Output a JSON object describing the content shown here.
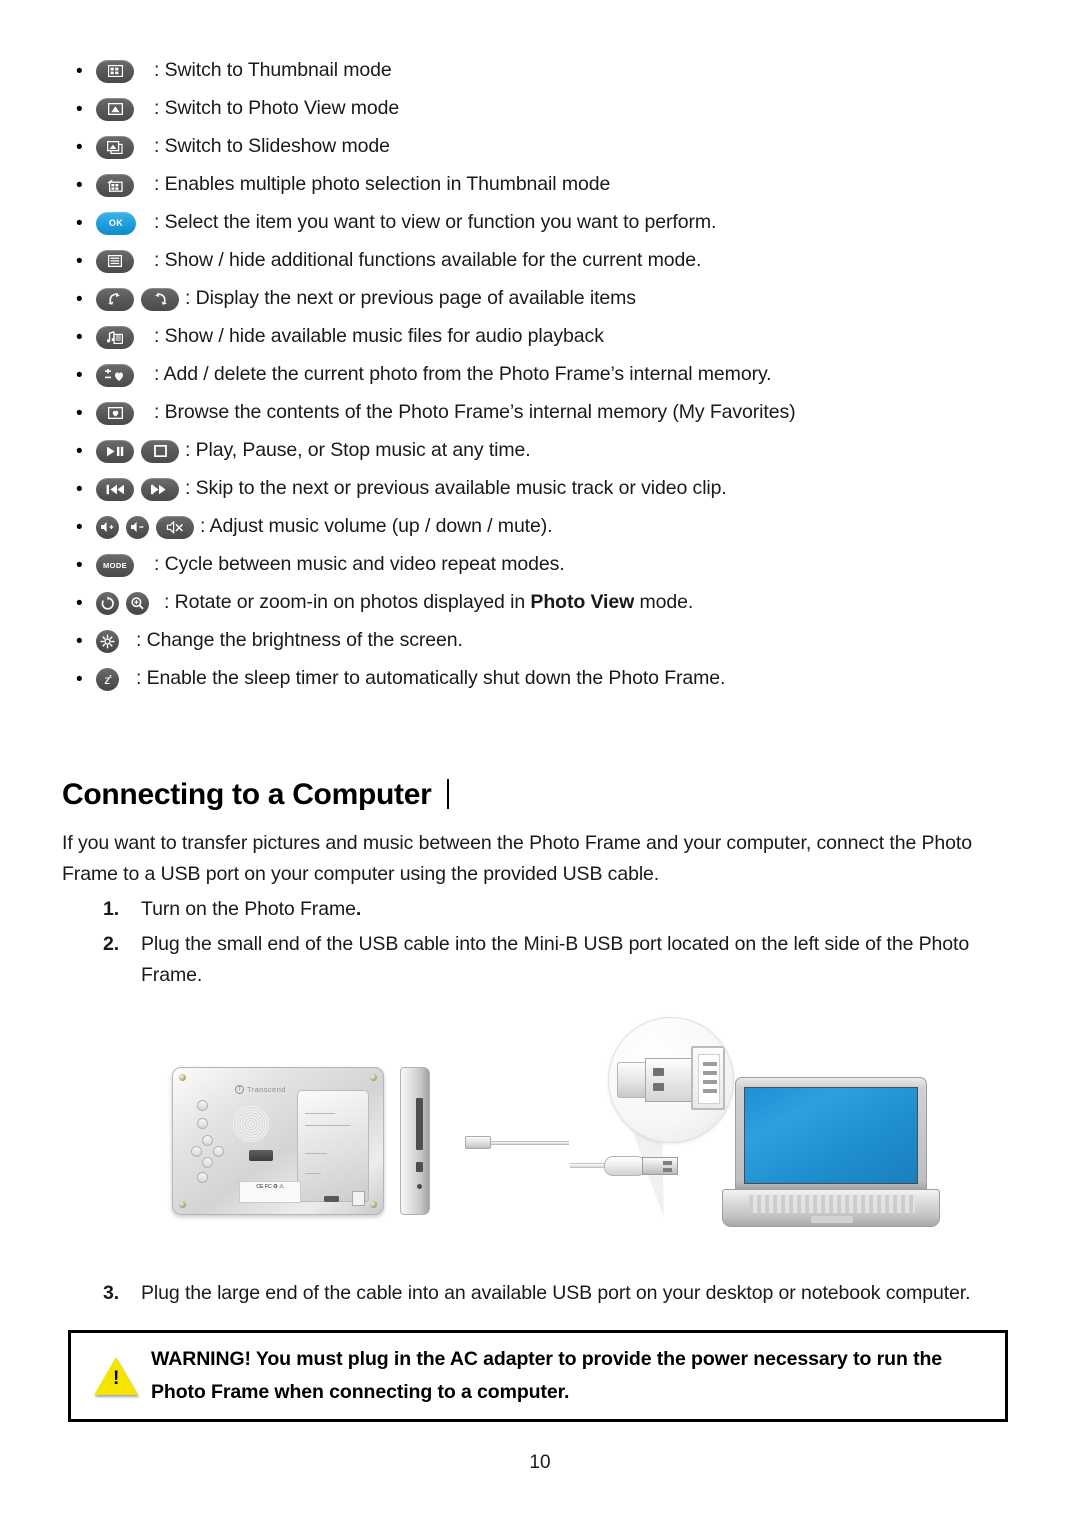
{
  "page_number": "10",
  "bullets": [
    {
      "icons": [
        "thumbnail-mode-icon"
      ],
      "text": ": Switch to Thumbnail mode"
    },
    {
      "icons": [
        "photo-view-mode-icon"
      ],
      "text": ": Switch to Photo View mode"
    },
    {
      "icons": [
        "slideshow-mode-icon"
      ],
      "text": ": Switch to Slideshow mode"
    },
    {
      "icons": [
        "multi-select-icon"
      ],
      "text": ": Enables multiple photo selection in Thumbnail mode"
    },
    {
      "icons": [
        "ok-button-icon"
      ],
      "text": ": Select the item you want to view or function you want to perform."
    },
    {
      "icons": [
        "menu-icon"
      ],
      "text": ": Show / hide additional functions available for the current mode."
    },
    {
      "icons": [
        "page-next-icon",
        "page-previous-icon"
      ],
      "text": ": Display the next or previous page of available items"
    },
    {
      "icons": [
        "music-files-icon"
      ],
      "text": ": Show / hide available music files for audio playback"
    },
    {
      "icons": [
        "favorite-add-delete-icon"
      ],
      "text": ": Add / delete the current photo from the Photo Frame’s internal memory."
    },
    {
      "icons": [
        "my-favorites-browse-icon"
      ],
      "text": ": Browse the contents of the Photo Frame’s internal memory (My Favorites)"
    },
    {
      "icons": [
        "play-pause-icon",
        "stop-icon"
      ],
      "text": ": Play, Pause, or Stop music at any time."
    },
    {
      "icons": [
        "previous-track-icon",
        "next-track-icon"
      ],
      "text": ": Skip to the next or previous available music track or video clip."
    },
    {
      "icons": [
        "volume-up-icon",
        "volume-down-icon",
        "mute-icon"
      ],
      "text": ": Adjust music volume (up / down / mute)."
    },
    {
      "icons": [
        "mode-button-icon"
      ],
      "text": ": Cycle between music and video repeat modes."
    },
    {
      "icons": [
        "rotate-icon",
        "zoom-in-icon"
      ],
      "text_pre": ": Rotate or zoom-in on photos displayed in ",
      "text_bold": "Photo View",
      "text_post": " mode."
    },
    {
      "icons": [
        "brightness-icon"
      ],
      "text": ": Change the brightness of the screen."
    },
    {
      "icons": [
        "sleep-timer-icon"
      ],
      "text": ": Enable the sleep timer to automatically shut down the Photo Frame."
    }
  ],
  "icon_labels": {
    "ok": "OK",
    "mode": "MODE"
  },
  "section": {
    "heading": "Connecting to a Computer",
    "paragraph": "If you want to transfer pictures and music between the Photo Frame and your computer, connect the Photo Frame to a USB port on your computer using the provided USB cable."
  },
  "steps": [
    {
      "num": "1.",
      "text_pre": "Turn on the Photo Frame",
      "text_bold": ".",
      "text_post": ""
    },
    {
      "num": "2.",
      "text_pre": "Plug the small end of the USB cable into the Mini-B USB port located on the left side of the Photo Frame.",
      "text_bold": "",
      "text_post": ""
    },
    {
      "num": "3.",
      "text_pre": "Plug the large end of the cable into an available USB port on your desktop or notebook computer.",
      "text_bold": "",
      "text_post": ""
    }
  ],
  "illustration": {
    "brand_logo_text": "Transcend",
    "brand_logo_mark": "T",
    "regulatory_label": "CE FC ♻ ⚠"
  },
  "warning": {
    "line1": "WARNING! You must plug in the AC adapter to provide the power necessary to run the",
    "line2": "Photo Frame when connecting to a computer."
  },
  "colors": {
    "ok_button_blue": "#1f9ddb",
    "icon_gray": "#565656",
    "warning_yellow": "#f5e400",
    "laptop_screen_blue": "#1f8fd0"
  }
}
